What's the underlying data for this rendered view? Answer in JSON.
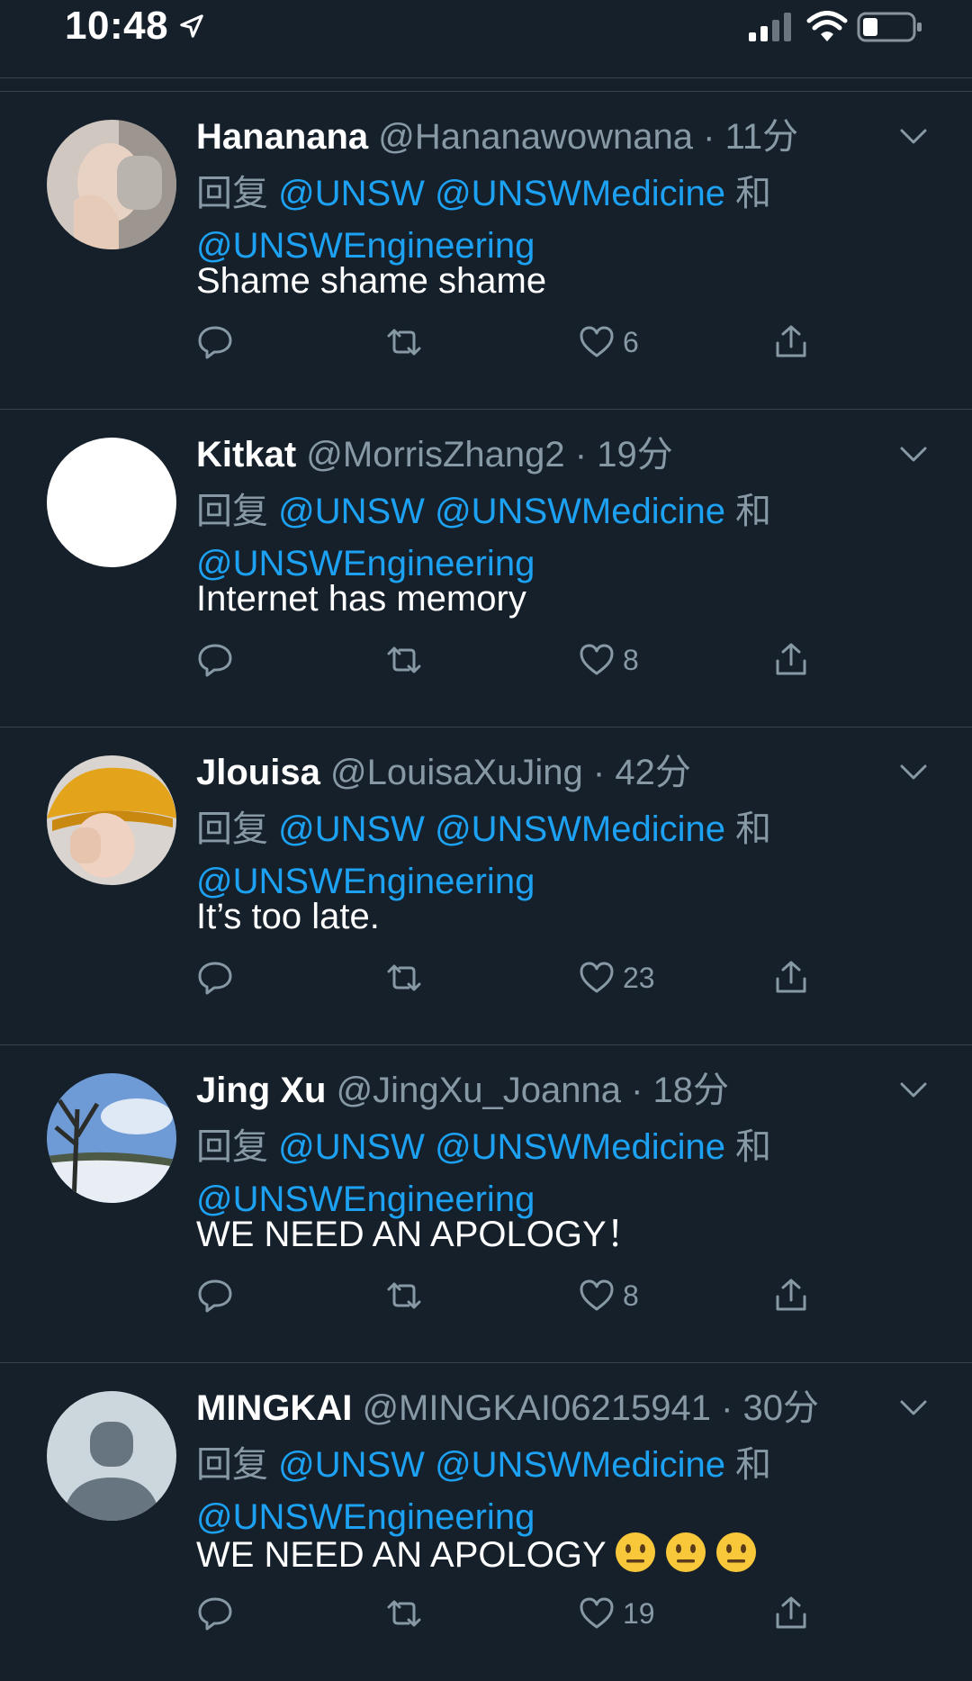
{
  "status_bar": {
    "time": "10:48"
  },
  "tweets": [
    {
      "name": "Hananana",
      "handle": "@Hananawownana",
      "separator": "·",
      "time": "11分",
      "reply_prefix": "回复",
      "mention_1": "@UNSW",
      "mention_2": "@UNSWMedicine",
      "conjunction": "和",
      "mention_3": "@UNSWEngineering",
      "text": "Shame shame shame",
      "likes": "6"
    },
    {
      "name": "Kitkat",
      "handle": "@MorrisZhang2",
      "separator": "·",
      "time": "19分",
      "reply_prefix": "回复",
      "mention_1": "@UNSW",
      "mention_2": "@UNSWMedicine",
      "conjunction": "和",
      "mention_3": "@UNSWEngineering",
      "text": "Internet has memory",
      "likes": "8"
    },
    {
      "name": "Jlouisa",
      "handle": "@LouisaXuJing",
      "separator": "·",
      "time": "42分",
      "reply_prefix": "回复",
      "mention_1": "@UNSW",
      "mention_2": "@UNSWMedicine",
      "conjunction": "和",
      "mention_3": "@UNSWEngineering",
      "text": "It’s too late.",
      "likes": "23"
    },
    {
      "name": "Jing Xu",
      "handle": "@JingXu_Joanna",
      "separator": "·",
      "time": "18分",
      "reply_prefix": "回复",
      "mention_1": "@UNSW",
      "mention_2": "@UNSWMedicine",
      "conjunction": "和",
      "mention_3": "@UNSWEngineering",
      "text": "WE NEED AN APOLOGY！",
      "likes": "8"
    },
    {
      "name": "MINGKAI",
      "handle": "@MINGKAI06215941",
      "separator": "·",
      "time": "30分",
      "reply_prefix": "回复",
      "mention_1": "@UNSW",
      "mention_2": "@UNSWMedicine",
      "conjunction": "和",
      "mention_3": "@UNSWEngineering",
      "text": "WE NEED AN APOLOGY",
      "text_emoji": "neutral-face x3",
      "likes": "19"
    }
  ],
  "colors": {
    "background": "#15202b",
    "secondary_text": "#8899a6",
    "mention": "#1da1f2",
    "divider": "#38444d"
  },
  "icons": {
    "reply": "reply-icon",
    "retweet": "retweet-icon",
    "like": "heart-icon",
    "share": "share-icon",
    "caret": "chevron-down-icon"
  }
}
